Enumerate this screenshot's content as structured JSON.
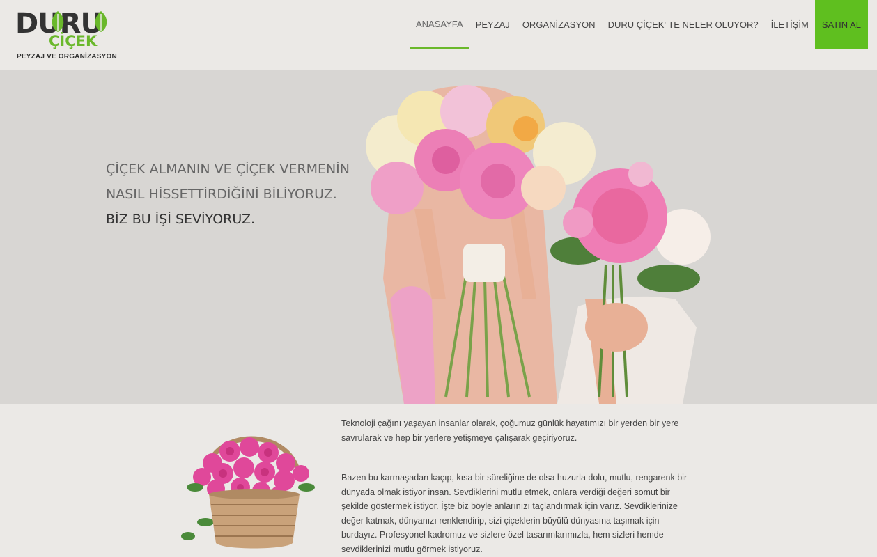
{
  "brand": {
    "name_line1": "DURU",
    "name_line2": "ÇİÇEK",
    "tagline": "PEYZAJ VE ORGANİZASYON",
    "accent_color": "#6ab82b"
  },
  "nav": {
    "items": [
      {
        "label": "ANASAYFA",
        "active": true
      },
      {
        "label": "PEYZAJ"
      },
      {
        "label": "ORGANİZASYON"
      },
      {
        "label": "DURU ÇİÇEK' TE NELER OLUYOR?"
      },
      {
        "label": "İLETİŞİM"
      }
    ],
    "cta": {
      "label": "SATIN AL",
      "color": "#5fbf1f"
    }
  },
  "hero": {
    "line1": "ÇİÇEK ALMANIN VE ÇİÇEK VERMENİN",
    "line2": "NASIL HİSSETTİRDİĞİNİ BİLİYORUZ.",
    "line3": "BİZ BU İŞİ SEVİYORUZ.",
    "image": "woman-holding-flower-bouquets"
  },
  "about": {
    "image": "flower-basket",
    "paragraph1": "Teknoloji çağını yaşayan insanlar olarak, çoğumuz günlük hayatımızı bir yerden bir yere savrularak ve hep bir yerlere yetişmeye çalışarak geçiriyoruz.",
    "paragraph2": "Bazen bu karmaşadan kaçıp, kısa bir süreliğine de olsa huzurla dolu, mutlu, rengarenk bir dünyada olmak istiyor insan. Sevdiklerini mutlu etmek, onlara verdiği değeri somut bir şekilde göstermek istiyor. İşte biz böyle anlarınızı taçlandırmak için varız. Sevdiklerinize değer katmak, dünyanızı renklendirip, sizi çiçeklerin büyülü dünyasına taşımak için burdayız. Profesyonel kadromuz ve sizlere özel tasarımlarımızla, hem sizleri hemde sevdiklerinizi mutlu görmek istiyoruz."
  }
}
